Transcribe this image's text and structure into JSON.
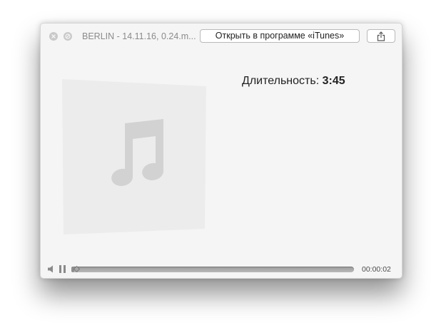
{
  "window": {
    "filename": "BERLIN - 14.11.16, 0.24.m...",
    "open_button_label": "Открыть в программе «iTunes»"
  },
  "info": {
    "duration_label": "Длительность: ",
    "duration_value": "3:45"
  },
  "player": {
    "elapsed": "00:00:02",
    "progress_fraction": 0.009,
    "state": "playing"
  },
  "icons": {
    "close": "close-icon",
    "nofullscreen": "no-fullscreen-icon",
    "share": "share-icon",
    "artwork": "music-note-icon",
    "volume": "volume-icon",
    "pause": "pause-icon"
  },
  "colors": {
    "window_bg": "#f5f5f5",
    "artwork_tile": "#ececec",
    "artwork_note": "#d2d2d2",
    "control_gray": "#8a8a8a"
  }
}
